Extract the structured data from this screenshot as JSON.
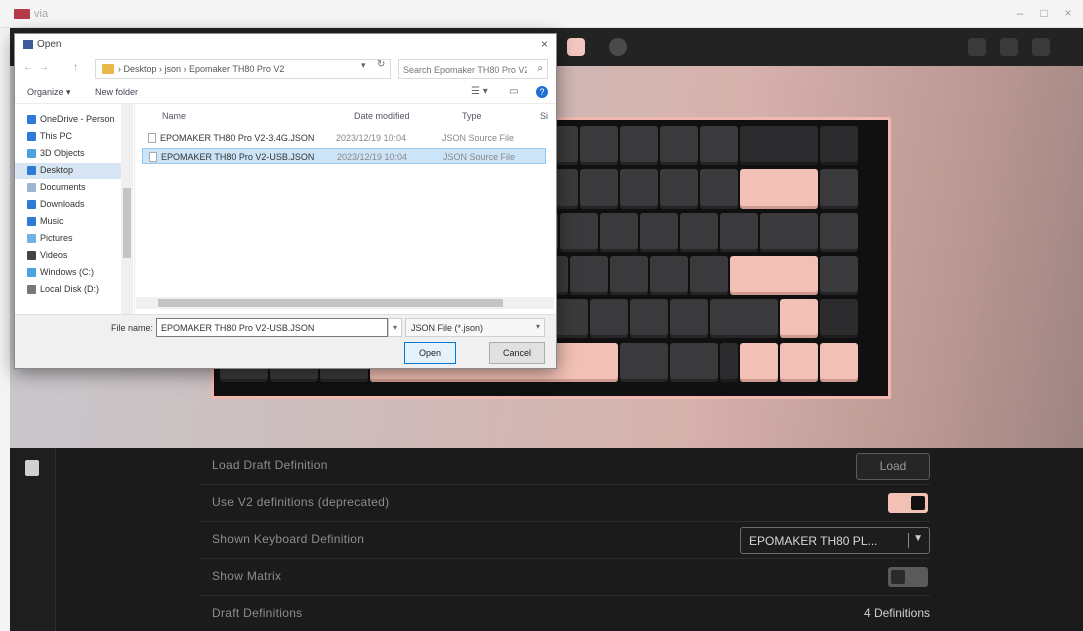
{
  "app": {
    "title": "via",
    "controls": {
      "minimize": "–",
      "maximize": "□",
      "close": "×"
    }
  },
  "toolbar": {
    "icons": [
      "keyboard-icon",
      "settings-icon"
    ],
    "right_icons": [
      "code-icon",
      "gear-icon",
      "design-icon"
    ]
  },
  "keyboard": {
    "accent_color": "#f2c0b5",
    "frame_color": "#f0b8ae",
    "key_color": "#3a3a3c"
  },
  "dialog": {
    "title": "Open",
    "close": "×",
    "nav": {
      "back": "←",
      "forward": "→",
      "up": "↑"
    },
    "address": "› Desktop › json › Epomaker TH80 Pro V2",
    "search_placeholder": "Search Epomaker TH80 Pro V2",
    "commands": {
      "organize": "Organize ▾",
      "new_folder": "New folder"
    },
    "help": "?",
    "nav_items": [
      {
        "label": "OneDrive - Person",
        "color": "#2d7bd6",
        "selected": false
      },
      {
        "label": "This PC",
        "color": "#2d7bd6",
        "selected": false
      },
      {
        "label": "3D Objects",
        "color": "#4aa3e0",
        "selected": false
      },
      {
        "label": "Desktop",
        "color": "#2d7bd6",
        "selected": true
      },
      {
        "label": "Documents",
        "color": "#9cb6d6",
        "selected": false
      },
      {
        "label": "Downloads",
        "color": "#2d7bd6",
        "selected": false
      },
      {
        "label": "Music",
        "color": "#2d7bd6",
        "selected": false
      },
      {
        "label": "Pictures",
        "color": "#6fb3e6",
        "selected": false
      },
      {
        "label": "Videos",
        "color": "#444444",
        "selected": false
      },
      {
        "label": "Windows (C:)",
        "color": "#4aa3e0",
        "selected": false
      },
      {
        "label": "Local Disk (D:)",
        "color": "#777777",
        "selected": false
      }
    ],
    "columns": {
      "name": "Name",
      "date": "Date modified",
      "type": "Type",
      "size": "Si"
    },
    "files": [
      {
        "name": "EPOMAKER TH80 Pro V2-3.4G.JSON",
        "date": "2023/12/19 10:04",
        "type": "JSON Source File",
        "selected": false
      },
      {
        "name": "EPOMAKER TH80 Pro V2-USB.JSON",
        "date": "2023/12/19 10:04",
        "type": "JSON Source File",
        "selected": true
      }
    ],
    "file_name_label": "File name:",
    "file_name_value": "EPOMAKER TH80 Pro V2-USB.JSON",
    "file_type": "JSON File (*.json)",
    "open_label": "Open",
    "cancel_label": "Cancel"
  },
  "settings": {
    "rows": [
      {
        "label": "Load Draft Definition",
        "control": "button",
        "button_label": "Load"
      },
      {
        "label": "Use V2 definitions (deprecated)",
        "control": "toggle",
        "on": true
      },
      {
        "label": "Shown Keyboard Definition",
        "control": "select",
        "value": "EPOMAKER TH80 PL..."
      },
      {
        "label": "Show Matrix",
        "control": "toggle",
        "on": false
      },
      {
        "label": "Draft Definitions",
        "control": "text",
        "value": "4 Definitions"
      }
    ]
  }
}
